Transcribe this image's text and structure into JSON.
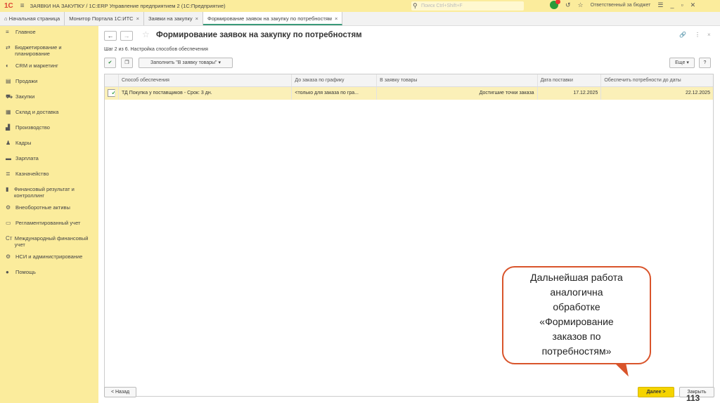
{
  "app": {
    "title": "ЗАЯВКИ НА ЗАКУПКУ / 1С:ERP Управление предприятием 2  (1С:Предприятие)",
    "search_placeholder": "Поиск Ctrl+Shift+F",
    "notifications": "1",
    "user": "Ответственный за бюджет"
  },
  "tabs": [
    {
      "label": "Начальная страница"
    },
    {
      "label": "Монитор Портала 1С:ИТС"
    },
    {
      "label": "Заявки на закупку"
    },
    {
      "label": "Формирование заявок на закупку по потребностям"
    }
  ],
  "sidebar": {
    "items": [
      {
        "label": "Главное",
        "icon": "≡"
      },
      {
        "label": "Бюджетирование и планирование",
        "icon": "⇄"
      },
      {
        "label": "CRM и маркетинг",
        "icon": "◐"
      },
      {
        "label": "Продажи",
        "icon": "▤"
      },
      {
        "label": "Закупки",
        "icon": "⛟"
      },
      {
        "label": "Склад и доставка",
        "icon": "▦"
      },
      {
        "label": "Производство",
        "icon": "▟"
      },
      {
        "label": "Кадры",
        "icon": "♟"
      },
      {
        "label": "Зарплата",
        "icon": "▬"
      },
      {
        "label": "Казначейство",
        "icon": "≣"
      },
      {
        "label": "Финансовый результат и контроллинг",
        "icon": "▮"
      },
      {
        "label": "Внеоборотные активы",
        "icon": "⚙"
      },
      {
        "label": "Регламентированный учет",
        "icon": "▭"
      },
      {
        "label": "Международный финансовый учет",
        "icon": "Ст"
      },
      {
        "label": "НСИ и администрирование",
        "icon": "⚙"
      },
      {
        "label": "Помощь",
        "icon": "●"
      }
    ]
  },
  "form": {
    "title": "Формирование заявок на закупку по потребностям",
    "step": "Шаг 2 из 6. Настройка способов обеспечения",
    "fill_button": "Заполнить \"В заявку товары\"",
    "more_button": "Еще",
    "help_button": "?"
  },
  "table": {
    "columns": [
      "Способ обеспечения",
      "До заказа по графику",
      "В заявку товары",
      "Дата поставки",
      "Обеспечить потребности до даты"
    ],
    "rows": [
      {
        "checked": true,
        "method": "ТД Покупка у поставщиков - Срок: 3 дн.",
        "schedule": "<только для заказа по гра...",
        "goods": "Достигшие точки заказа",
        "delivery": "17.12.2025",
        "until": "22.12.2025"
      }
    ]
  },
  "callout": {
    "lines": [
      "Дальнейшая работа",
      "аналогична",
      "обработке",
      "«Формирование",
      "заказов по",
      "потребностям»"
    ]
  },
  "footer": {
    "back": "< Назад",
    "next": "Далее >",
    "close": "Закрыть",
    "page": "113"
  }
}
